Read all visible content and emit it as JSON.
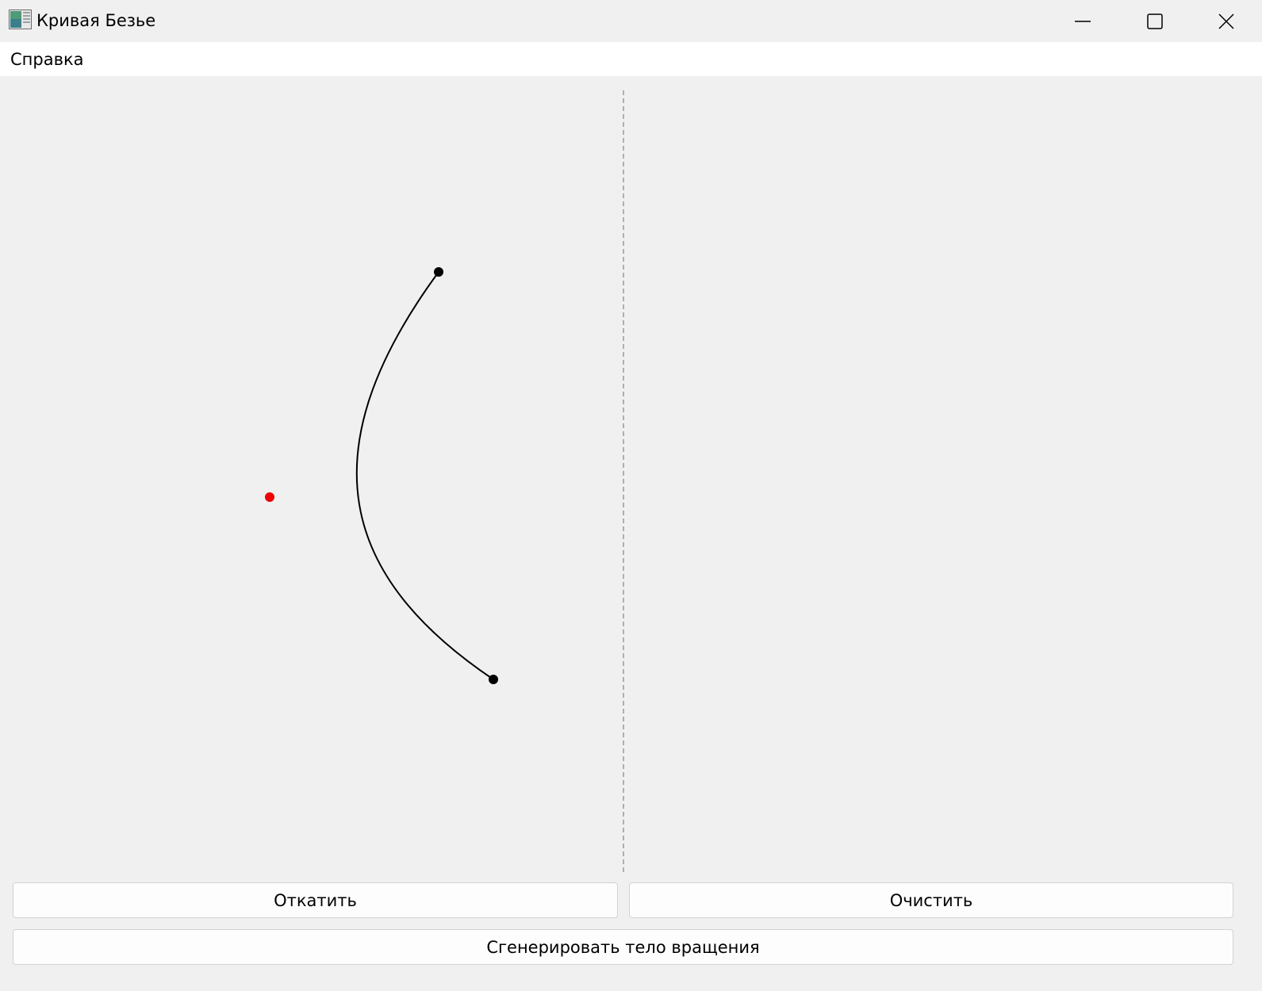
{
  "window": {
    "title": "Кривая Безье",
    "icon": "app-window-icon",
    "controls": {
      "minimize": "minimize-icon",
      "maximize": "maximize-icon",
      "close": "close-icon"
    }
  },
  "menu": {
    "items": [
      {
        "label": "Справка"
      }
    ]
  },
  "canvas": {
    "curve_color": "#000000",
    "control_point_color": "#ee0000",
    "axis_color": "#999999"
  },
  "buttons": {
    "undo": "Откатить",
    "clear": "Очистить",
    "generate": "Сгенерировать тело вращения"
  }
}
